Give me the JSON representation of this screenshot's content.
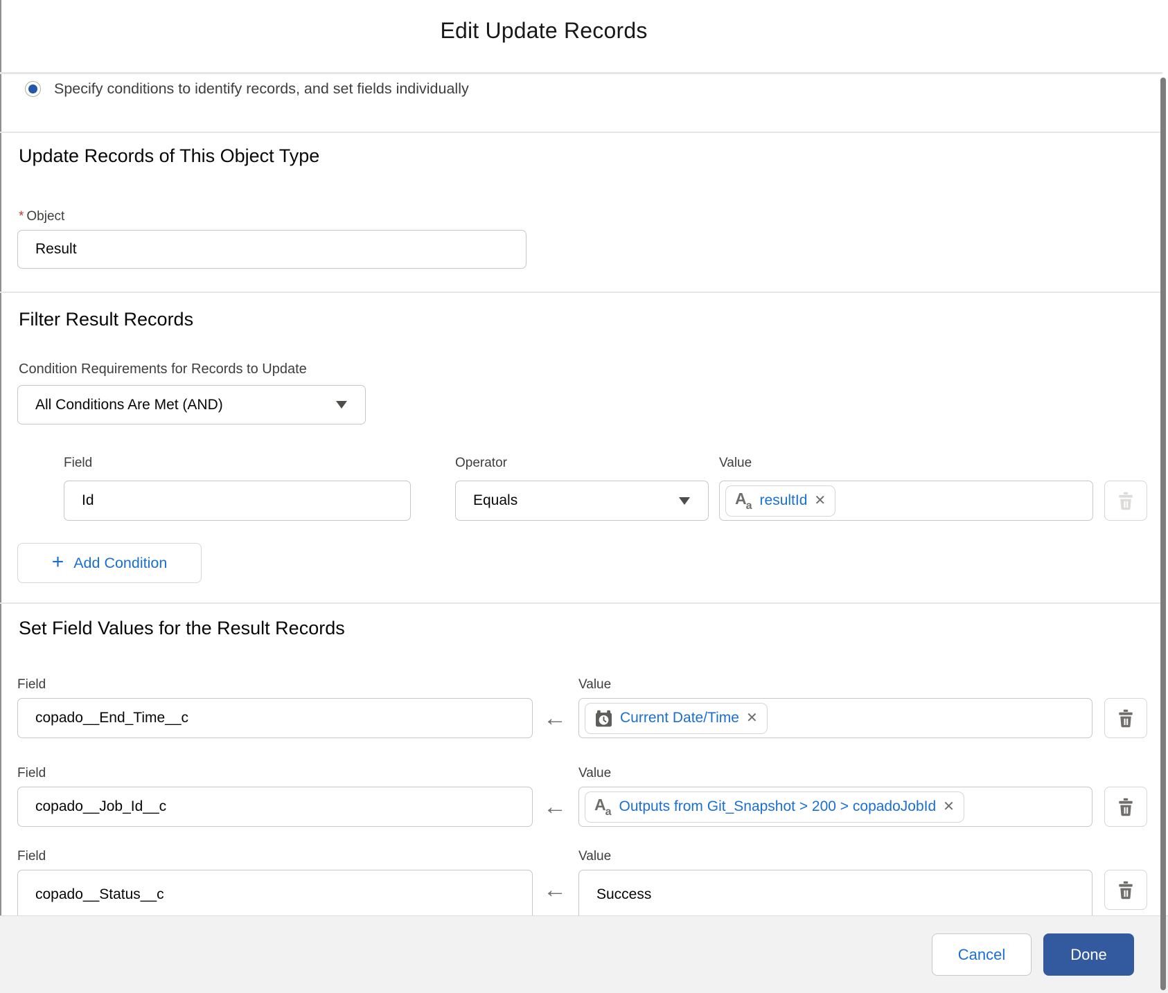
{
  "dialog": {
    "title": "Edit Update Records"
  },
  "record_mode": {
    "selected_option": "Specify conditions to identify records, and set fields individually"
  },
  "object_section": {
    "heading": "Update Records of This Object Type",
    "required_marker": "*",
    "object_label": "Object",
    "object_value": "Result"
  },
  "filter_section": {
    "heading": "Filter Result Records",
    "condition_requirements_label": "Condition Requirements for Records to Update",
    "condition_requirements_value": "All Conditions Are Met (AND)",
    "columns": {
      "field": "Field",
      "operator": "Operator",
      "value": "Value"
    },
    "condition_row": {
      "field": "Id",
      "operator": "Equals",
      "value_pill": "resultId"
    },
    "add_condition_label": "Add Condition"
  },
  "set_values_section": {
    "heading": "Set Field Values for the Result Records",
    "field_label": "Field",
    "value_label": "Value",
    "rows": [
      {
        "field": "copado__End_Time__c",
        "value": "Current Date/Time"
      },
      {
        "field": "copado__Job_Id__c",
        "value": "Outputs from Git_Snapshot > 200 > copadoJobId"
      },
      {
        "field": "copado__Status__c",
        "value": "Success"
      }
    ]
  },
  "footer": {
    "cancel_label": "Cancel",
    "done_label": "Done"
  },
  "icons": {
    "text_type": "A",
    "text_type_sub": "a",
    "close": "✕",
    "arrow_left": "←",
    "plus": "+"
  },
  "colors": {
    "link_blue": "#1a6fd4",
    "done_button": "#33599e",
    "required_red": "#c23934",
    "icon_gray": "#706e6b",
    "radio_blue": "#2457a5"
  }
}
